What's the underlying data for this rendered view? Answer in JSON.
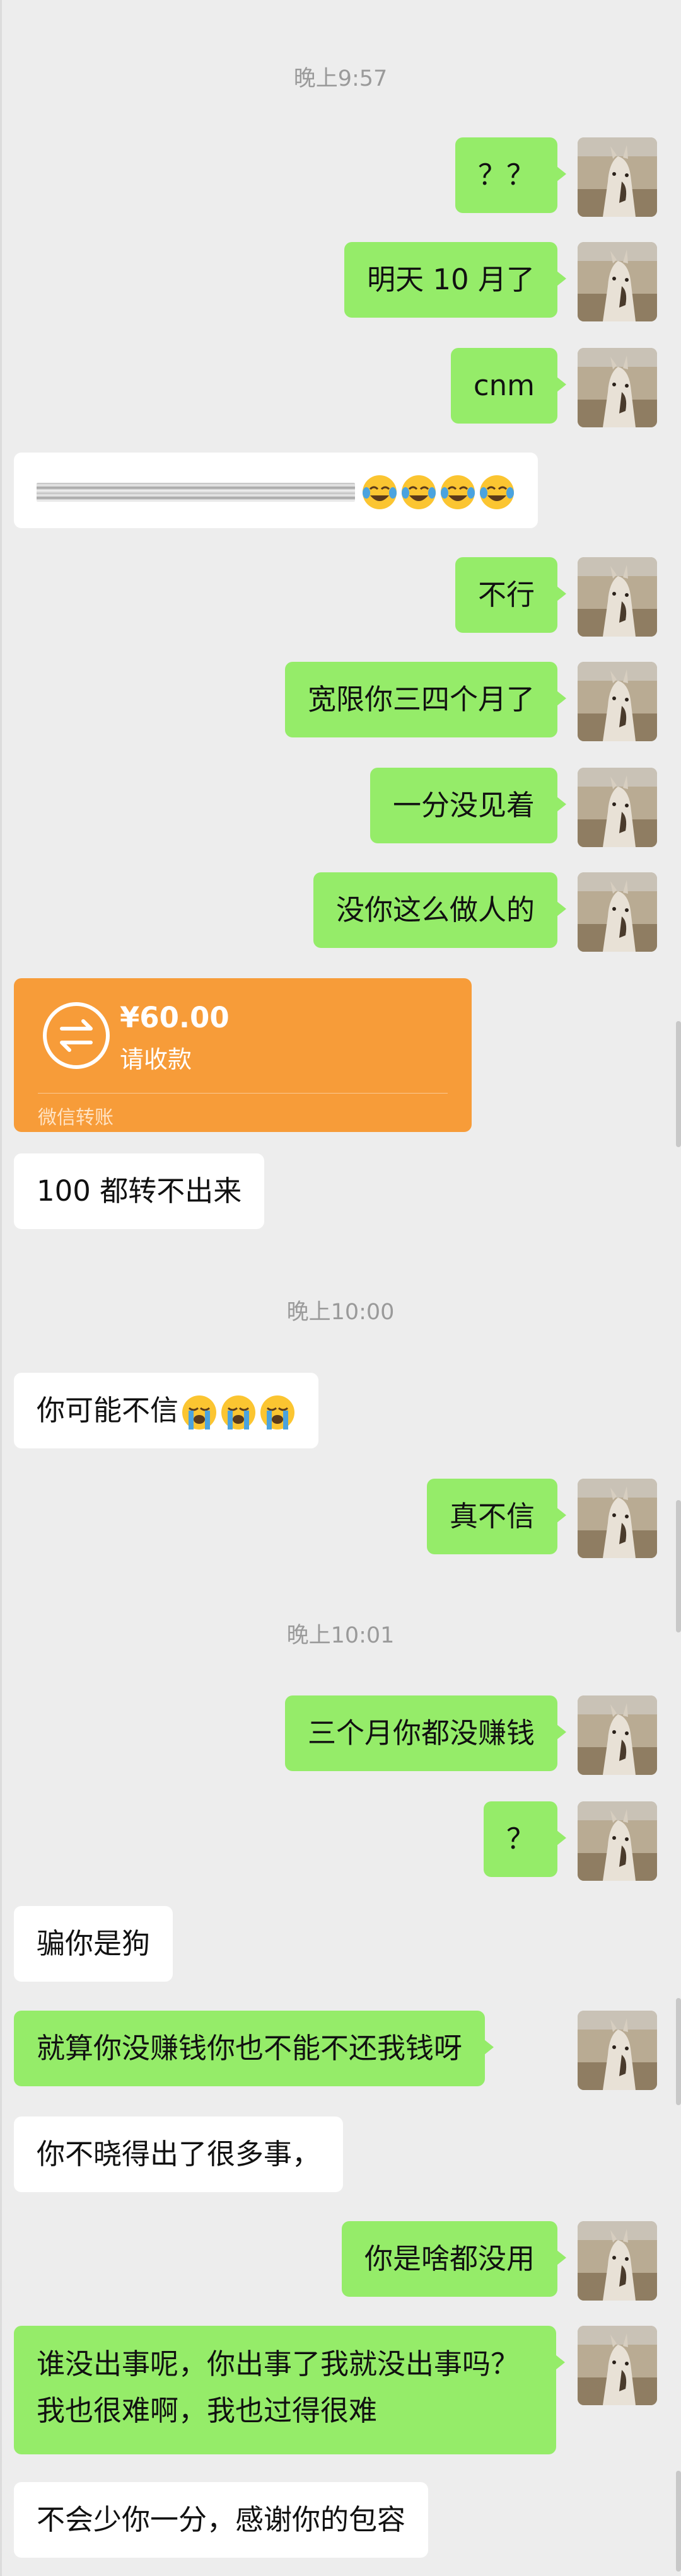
{
  "timestamps": {
    "t1": "晚上9:57",
    "t2": "晚上10:00",
    "t3": "晚上10:01"
  },
  "messages": {
    "m1": "？？",
    "m2": "明天 10 月了",
    "m3": "cnm",
    "m5": "不行",
    "m6": "宽限你三四个月了",
    "m7": "一分没见着",
    "m8": "没你这么做人的",
    "m10": "100 都转不出来",
    "m11": "你可能不信",
    "m12": "真不信",
    "m13": "三个月你都没赚钱",
    "m14": "？",
    "m15": "骗你是狗",
    "m16": "就算你没赚钱你也不能不还我钱呀",
    "m17": "你不晓得出了很多事，",
    "m18": "你是啥都没用",
    "m19": "谁没出事呢，你出事了我就没出事吗？我也很难啊，我也过得很难",
    "m20": "不会少你一分，感谢你的包容"
  },
  "transfer": {
    "amount": "¥60.00",
    "status": "请收款",
    "footer": "微信转账"
  },
  "icons": {
    "avatar": "horse-avatar-icon",
    "laugh_cry": "face-with-tears-of-joy-icon",
    "crying": "loudly-crying-face-icon",
    "transfer": "transfer-arrows-icon"
  },
  "colors": {
    "sent_bubble": "#95ec69",
    "received_bubble": "#ffffff",
    "transfer_card": "#f79c39",
    "background": "#ededed"
  }
}
